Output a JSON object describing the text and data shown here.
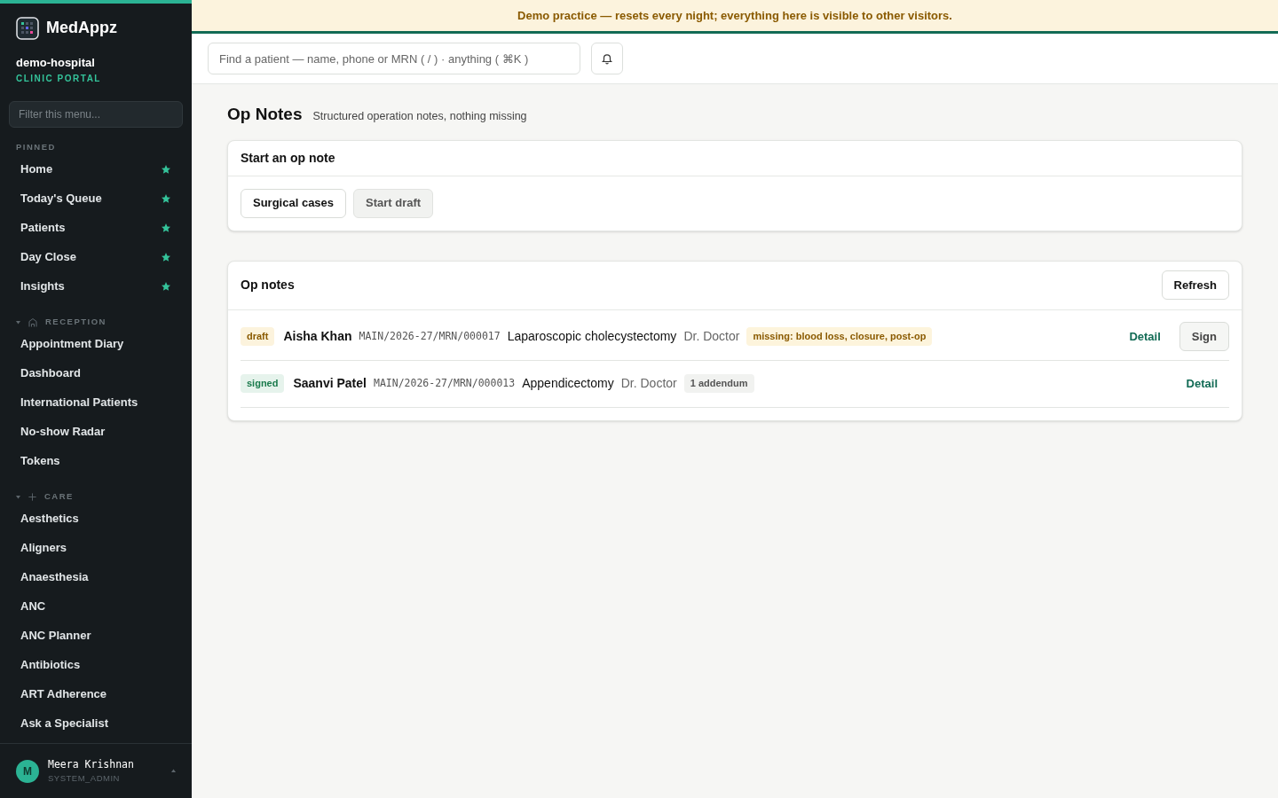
{
  "sidebar": {
    "brand": "MedAppz",
    "org": "demo-hospital",
    "portal": "CLINIC PORTAL",
    "filter": {
      "placeholder": "Filter this menu..."
    },
    "sections": [
      {
        "title": "PINNED",
        "kind": "pinned",
        "items": [
          {
            "label": "Home",
            "starred": true
          },
          {
            "label": "Today's Queue",
            "starred": true
          },
          {
            "label": "Patients",
            "starred": true
          },
          {
            "label": "Day Close",
            "starred": true
          },
          {
            "label": "Insights",
            "starred": true
          }
        ]
      },
      {
        "title": "RECEPTION",
        "kind": "reception",
        "expanded": true,
        "items": [
          {
            "label": "Appointment Diary",
            "starred": false
          },
          {
            "label": "Dashboard",
            "starred": false
          },
          {
            "label": "International Patients",
            "starred": false
          },
          {
            "label": "No-show Radar",
            "starred": false
          },
          {
            "label": "Tokens",
            "starred": false
          }
        ]
      },
      {
        "title": "CARE",
        "kind": "care",
        "expanded": true,
        "items": [
          {
            "label": "Aesthetics",
            "starred": false
          },
          {
            "label": "Aligners",
            "starred": false
          },
          {
            "label": "Anaesthesia",
            "starred": false
          },
          {
            "label": "ANC",
            "starred": false
          },
          {
            "label": "ANC Planner",
            "starred": false
          },
          {
            "label": "Antibiotics",
            "starred": false
          },
          {
            "label": "ART Adherence",
            "starred": false
          },
          {
            "label": "Ask a Specialist",
            "starred": false
          }
        ]
      }
    ],
    "user": {
      "initial": "M",
      "name": "Meera Krishnan",
      "role": "SYSTEM_ADMIN"
    }
  },
  "banner": "Demo practice — resets every night; everything here is visible to other visitors.",
  "search": {
    "placeholder": "Find a patient — name, phone or MRN ( / ) · anything ( ⌘K )"
  },
  "page": {
    "title": "Op Notes",
    "subtitle": "Structured operation notes, nothing missing"
  },
  "start_card": {
    "title": "Start an op note",
    "buttons": [
      {
        "label": "Surgical cases",
        "disabled": false
      },
      {
        "label": "Start draft",
        "disabled": true
      }
    ]
  },
  "notes_card": {
    "title": "Op notes",
    "refresh": "Refresh",
    "rows": [
      {
        "status": {
          "label": "draft",
          "kind": "draft"
        },
        "patient": "Aisha Khan",
        "mrn": "MAIN/2026-27/MRN/000017",
        "procedure": "Laparoscopic cholecystectomy",
        "doctor": "Dr. Doctor",
        "tag": {
          "label": "missing: blood loss, closure, post-op",
          "kind": "warning"
        },
        "detail": "Detail",
        "sign": "Sign"
      },
      {
        "status": {
          "label": "signed",
          "kind": "signed"
        },
        "patient": "Saanvi Patel",
        "mrn": "MAIN/2026-27/MRN/000013",
        "procedure": "Appendicectomy",
        "doctor": "Dr. Doctor",
        "tag": {
          "label": "1 addendum",
          "kind": "neutral"
        },
        "detail": "Detail"
      }
    ]
  }
}
